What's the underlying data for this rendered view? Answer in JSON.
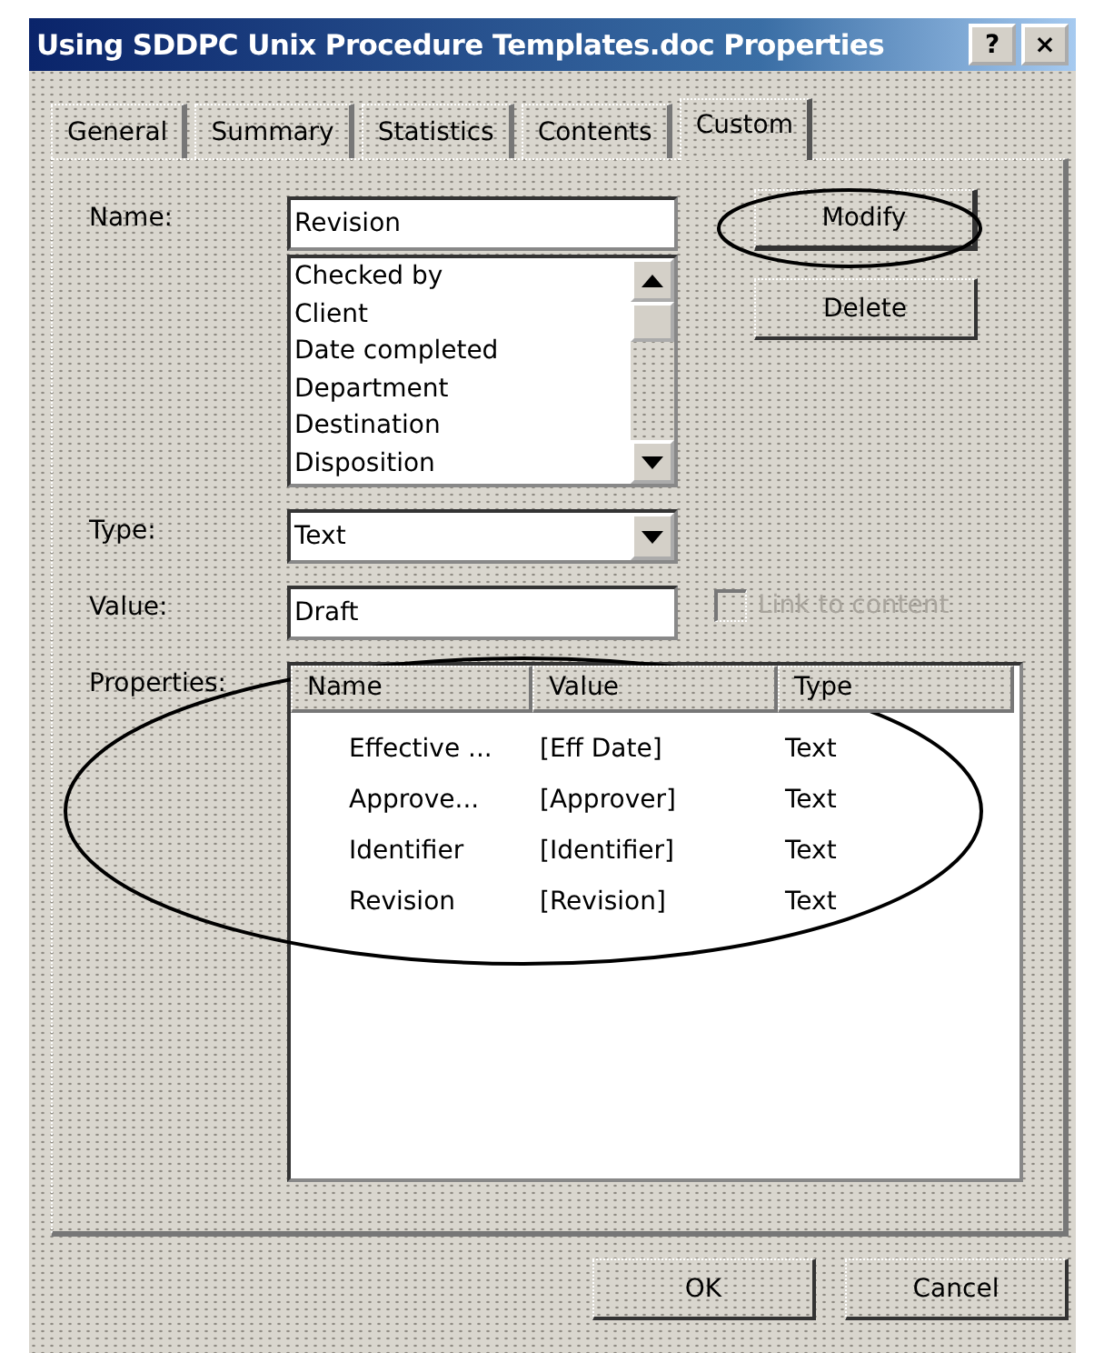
{
  "window": {
    "title": "Using SDDPC Unix Procedure Templates.doc Properties",
    "title_buttons": [
      {
        "kind": "help",
        "label": "?"
      },
      {
        "kind": "close",
        "label": "×"
      }
    ]
  },
  "tabs": [
    {
      "label": "General",
      "selected": false
    },
    {
      "label": "Summary",
      "selected": false
    },
    {
      "label": "Statistics",
      "selected": false
    },
    {
      "label": "Contents",
      "selected": false
    },
    {
      "label": "Custom",
      "selected": true
    }
  ],
  "name": {
    "label": "Name:",
    "value": "Revision",
    "list": [
      "Checked by",
      "Client",
      "Date completed",
      "Department",
      "Destination",
      "Disposition"
    ]
  },
  "type": {
    "label": "Type:",
    "value": "Text"
  },
  "value": {
    "label": "Value:",
    "value": "Draft"
  },
  "link_to_content": {
    "label": "Link to content",
    "checked": false,
    "disabled": true
  },
  "side_buttons": [
    {
      "label": "Modify",
      "default": true
    },
    {
      "label": "Delete",
      "default": false
    }
  ],
  "properties": {
    "label": "Properties:",
    "columns": [
      "Name",
      "Value",
      "Type"
    ],
    "rows": [
      [
        "Effective ...",
        "[Eff Date]",
        "Text"
      ],
      [
        "Approve...",
        "[Approver]",
        "Text"
      ],
      [
        "Identifier",
        "[Identifier]",
        "Text"
      ],
      [
        "Revision",
        "[Revision]",
        "Text"
      ]
    ]
  },
  "footer_buttons": [
    "OK",
    "Cancel"
  ]
}
